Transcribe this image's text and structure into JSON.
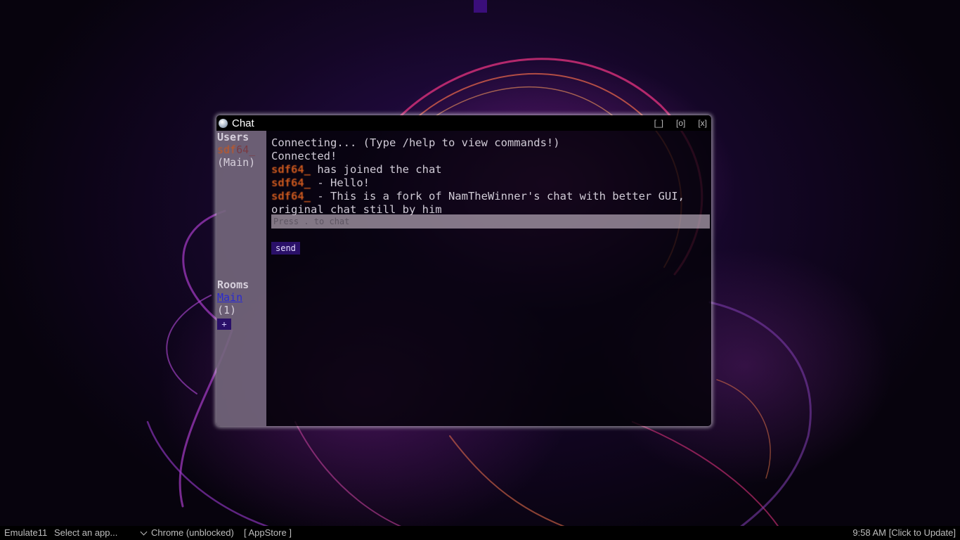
{
  "window": {
    "title": "Chat",
    "controls": {
      "minimize": "[_]",
      "maximize": "[o]",
      "close": "[x]"
    }
  },
  "sidebar": {
    "users_heading": "Users",
    "user": {
      "name_prefix": "sdf",
      "name_suffix": "64_",
      "room": "(Main)"
    },
    "rooms_heading": "Rooms",
    "room": {
      "name": "Main",
      "count": "(1)"
    },
    "add_room_label": "+"
  },
  "messages": [
    {
      "sender": "",
      "text": "Connecting... (Type /help to view commands!)"
    },
    {
      "sender": "",
      "text": "Connected!"
    },
    {
      "sender": "sdf64_",
      "text": " has joined the chat"
    },
    {
      "sender": "sdf64_",
      "text": " - Hello!"
    },
    {
      "sender": "sdf64_",
      "text": " - This is a fork of NamTheWinner's chat with better GUI, original chat still by him"
    }
  ],
  "input": {
    "placeholder": "Press . to chat",
    "value": ""
  },
  "send_label": "send",
  "taskbar": {
    "start_label": "Emulate11",
    "app_select": "Select an app...",
    "chrome": "Chrome (unblocked)",
    "appstore": "[ AppStore ]",
    "clock": "9:58 AM [Click to Update]"
  },
  "colors": {
    "username_accent": "#c9571e",
    "button_bg": "#2a1068",
    "room_link": "#2a2ad0"
  },
  "icons": {
    "app": "globe-icon",
    "dropdown": "chevron-down-icon"
  }
}
